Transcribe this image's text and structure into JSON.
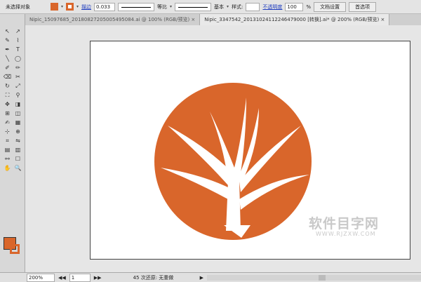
{
  "control_bar": {
    "selection": "未选择对象",
    "fill_color": "#d9662b",
    "stroke_color": "#d9662b",
    "stroke_label": "描边",
    "stroke_weight": "0.033",
    "profile1": "等比",
    "profile2": "基本",
    "style_label": "样式:",
    "opacity_label": "不透明度",
    "opacity_value": "100",
    "percent": "%",
    "doc_setup": "文档设置",
    "preferences": "首选项"
  },
  "tabs": [
    {
      "label": "Nipic_15097685_20180827205005495084.ai @ 100% (RGB/预览)",
      "close": "×"
    },
    {
      "label": "Nipic_3347542_20131024112246479000 [转换].ai* @ 200% (RGB/预览)",
      "close": "×"
    }
  ],
  "tools": [
    "↖",
    "↗",
    "✎",
    "⌇",
    "✒",
    "T",
    "╲",
    "◯",
    "✐",
    "✏",
    "⌫",
    "✂",
    "↻",
    "⤢",
    "⛶",
    "⚲",
    "✥",
    "◨",
    "⊞",
    "◫",
    "✍",
    "▦",
    "⊹",
    "⊕",
    "⌗",
    "⇋",
    "▤",
    "▥",
    "⚯",
    "☐",
    "✋",
    "🔍"
  ],
  "watermark": {
    "text": "软件目字网",
    "url": "WWW.RJZXW.COM"
  },
  "status": {
    "zoom": "200%",
    "page": "1",
    "undo": "45 次还原: 无重做"
  }
}
